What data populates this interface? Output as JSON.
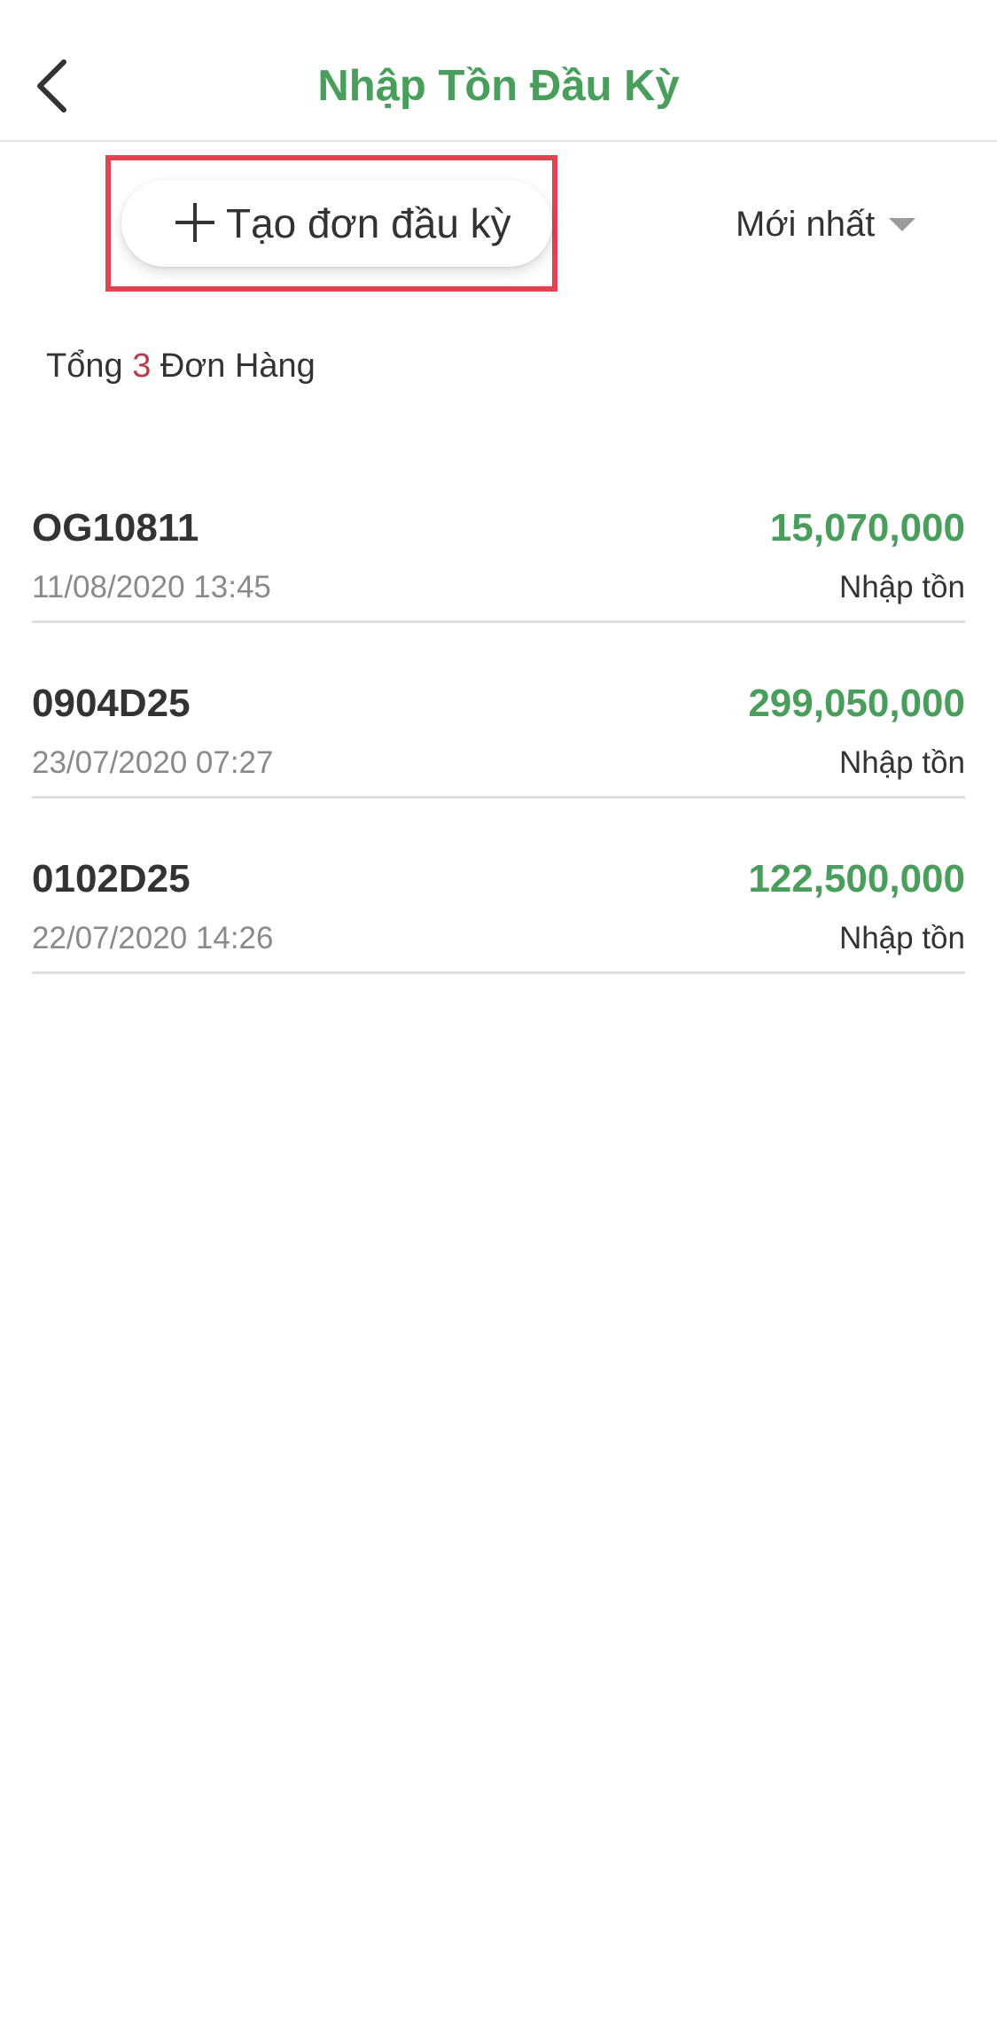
{
  "header": {
    "title": "Nhập Tồn Đầu Kỳ",
    "back_icon": "chevron-left-icon"
  },
  "toolbar": {
    "create_label": "Tạo đơn đầu kỳ",
    "create_icon": "plus-icon",
    "sort_label": "Mới nhất",
    "sort_icon": "caret-down-icon"
  },
  "summary": {
    "prefix": "Tổng",
    "count": "3",
    "suffix": "Đơn Hàng"
  },
  "orders": [
    {
      "code": "OG10811",
      "date": "11/08/2020 13:45",
      "amount": "15,070,000",
      "type": "Nhập tồn"
    },
    {
      "code": "0904D25",
      "date": "23/07/2020 07:27",
      "amount": "299,050,000",
      "type": "Nhập tồn"
    },
    {
      "code": "0102D25",
      "date": "22/07/2020 14:26",
      "amount": "122,500,000",
      "type": "Nhập tồn"
    }
  ],
  "colors": {
    "brand_green": "#4a9e5c",
    "highlight_red": "#e04450",
    "count_red": "#c0394a"
  }
}
